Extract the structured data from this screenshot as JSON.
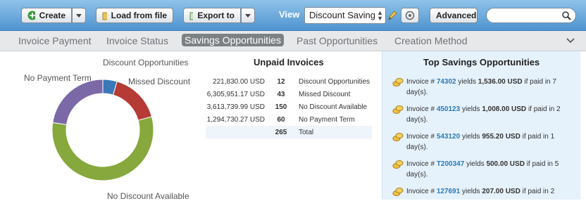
{
  "toolbar": {
    "create_label": "Create",
    "load_label": "Load from file",
    "export_label": "Export to",
    "view_label": "View",
    "view_value": "Discount Saving",
    "advanced_label": "Advanced",
    "search_placeholder": "",
    "colors": {
      "bar_top": "#8fc3ea",
      "bar_bottom": "#4f93cf"
    }
  },
  "tabs": [
    {
      "label": "Invoice Payment",
      "active": false
    },
    {
      "label": "Invoice Status",
      "active": false
    },
    {
      "label": "Savings Opportunities",
      "active": true
    },
    {
      "label": "Past Opportunities",
      "active": false
    },
    {
      "label": "Creation Method",
      "active": false
    }
  ],
  "donut": {
    "labels": {
      "discount_opportunities": "Discount Opportunities",
      "no_payment_term": "No Payment Term",
      "missed_discount": "Missed Discount",
      "no_discount_available": "No Discount Available"
    },
    "segments": [
      {
        "name": "Discount Opportunities",
        "value": 12,
        "color": "#3a78b8"
      },
      {
        "name": "Missed Discount",
        "value": 43,
        "color": "#b63a36"
      },
      {
        "name": "No Discount Available",
        "value": 150,
        "color": "#86a83c"
      },
      {
        "name": "No Payment Term",
        "value": 60,
        "color": "#7b68a6"
      }
    ]
  },
  "unpaid": {
    "title": "Unpaid Invoices",
    "rows": [
      {
        "amount": "221,830.00 USD",
        "count": "12",
        "label": "Discount Opportunities"
      },
      {
        "amount": "6,305,951.17 USD",
        "count": "43",
        "label": "Missed Discount"
      },
      {
        "amount": "3,613,739.99 USD",
        "count": "150",
        "label": "No Discount Available"
      },
      {
        "amount": "1,294,730.27 USD",
        "count": "60",
        "label": "No Payment Term"
      }
    ],
    "total": {
      "amount": "",
      "count": "265",
      "label": "Total"
    }
  },
  "top": {
    "title": "Top Savings Opportunities",
    "items": [
      {
        "prefix": "Invoice #",
        "invoice": "74302",
        "mid": "yields",
        "amount": "1,536.00 USD",
        "suffix": "if paid in 7 day(s)."
      },
      {
        "prefix": "Invoice #",
        "invoice": "450123",
        "mid": "yields",
        "amount": "1,008.00 USD",
        "suffix": "if paid in 2 day(s)."
      },
      {
        "prefix": "Invoice #",
        "invoice": "543120",
        "mid": "yields",
        "amount": "955.20 USD",
        "suffix": "if paid in 1 day(s)."
      },
      {
        "prefix": "Invoice #",
        "invoice": "T200347",
        "mid": "yields",
        "amount": "500.00 USD",
        "suffix": "if paid in 5 day(s)."
      },
      {
        "prefix": "Invoice #",
        "invoice": "127691",
        "mid": "yields",
        "amount": "207.00 USD",
        "suffix": "if paid in 2"
      }
    ]
  }
}
